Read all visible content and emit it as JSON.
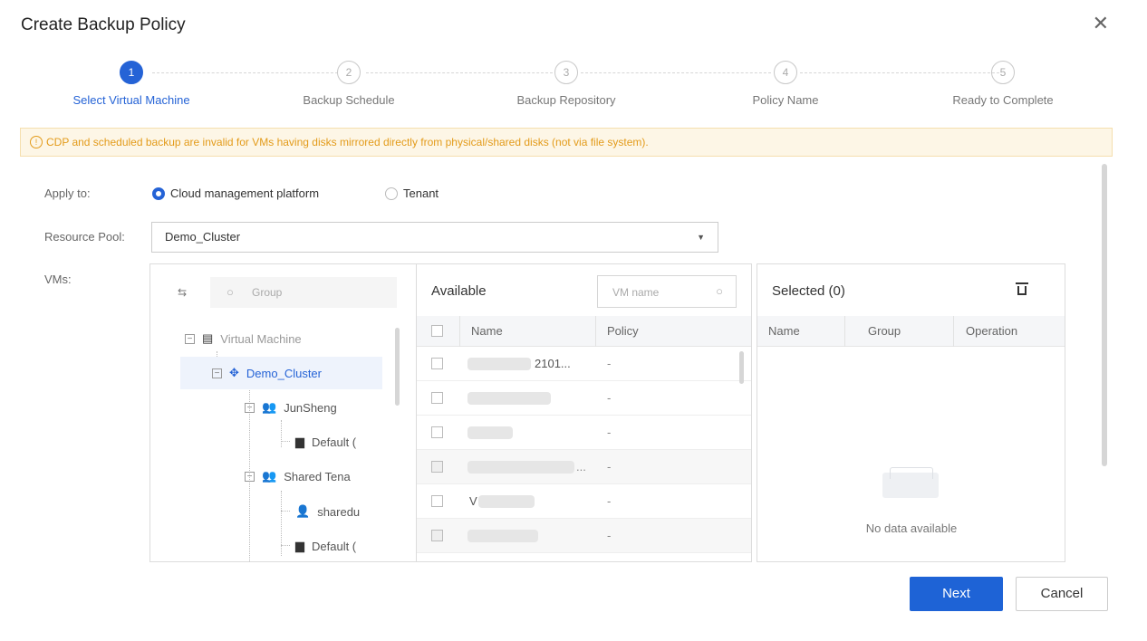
{
  "dialog": {
    "title": "Create Backup Policy",
    "close_icon": "close-icon"
  },
  "steps": [
    {
      "num": "1",
      "label": "Select Virtual Machine",
      "active": true
    },
    {
      "num": "2",
      "label": "Backup Schedule",
      "active": false
    },
    {
      "num": "3",
      "label": "Backup Repository",
      "active": false
    },
    {
      "num": "4",
      "label": "Policy Name",
      "active": false
    },
    {
      "num": "5",
      "label": "Ready to Complete",
      "active": false
    }
  ],
  "warning": {
    "icon": "info-icon",
    "text": "CDP and scheduled backup are invalid for VMs having disks mirrored directly from physical/shared disks (not via file system)."
  },
  "apply_to": {
    "label": "Apply to:",
    "options": [
      "Cloud management platform",
      "Tenant"
    ],
    "selected": "Cloud management platform"
  },
  "resource_pool": {
    "label": "Resource Pool:",
    "value": "Demo_Cluster"
  },
  "vms": {
    "label": "VMs:"
  },
  "tree": {
    "search_placeholder": "Group",
    "nodes": [
      "Virtual Machine",
      "Demo_Cluster",
      "JunSheng",
      "Default (",
      "Shared Tena",
      "sharedu",
      "Default ("
    ]
  },
  "available": {
    "title": "Available",
    "search_placeholder": "VM name",
    "columns": [
      "Name",
      "Policy"
    ],
    "rows": [
      {
        "name": "2101...",
        "policy": "-"
      },
      {
        "name": "",
        "policy": "-"
      },
      {
        "name": "",
        "policy": "-"
      },
      {
        "name": "...",
        "policy": "-"
      },
      {
        "name": "V",
        "policy": "-"
      },
      {
        "name": "",
        "policy": "-"
      }
    ]
  },
  "selected": {
    "title": "Selected (0)",
    "columns": [
      "Name",
      "Group",
      "Operation"
    ],
    "empty_text": "No data available"
  },
  "buttons": {
    "next": "Next",
    "cancel": "Cancel"
  },
  "colors": {
    "primary": "#1e63d6",
    "warning_bg": "#fdf6e6",
    "warning_text": "#e39b1a"
  }
}
